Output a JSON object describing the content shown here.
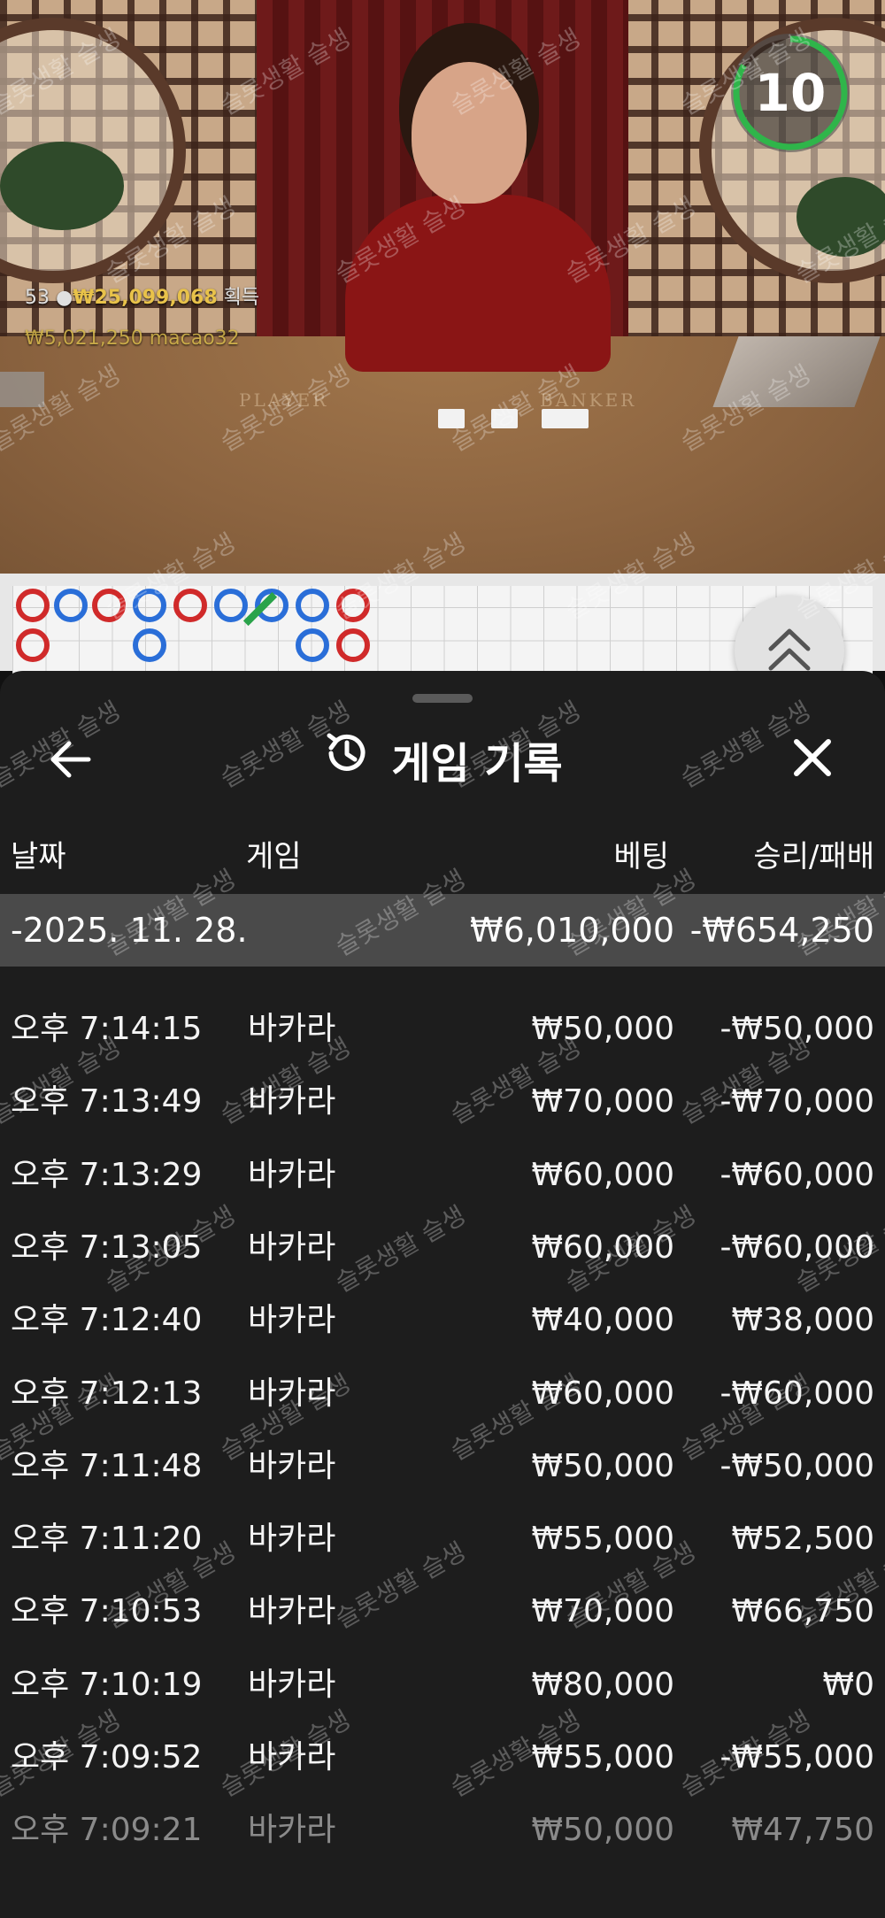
{
  "video": {
    "timer": "10",
    "win_count": "53",
    "win_amount": "₩25,099,068",
    "win_suffix": "획득",
    "user_line": "₩5,021,250 macao32",
    "felt_player": "PLAYER",
    "felt_banker": "BANKER"
  },
  "watermark": "슬롯생활 슬생",
  "panel": {
    "title": "게임 기록",
    "columns": {
      "date": "날짜",
      "game": "게임",
      "bet": "베팅",
      "result": "승리/패배"
    },
    "date_group": {
      "date": "-2025. 11. 28.",
      "bet": "₩6,010,000",
      "result": "-₩654,250"
    },
    "rows": [
      {
        "time": "오후 7:14:15",
        "game": "바카라",
        "bet": "₩50,000",
        "result": "-₩50,000"
      },
      {
        "time": "오후 7:13:49",
        "game": "바카라",
        "bet": "₩70,000",
        "result": "-₩70,000"
      },
      {
        "time": "오후 7:13:29",
        "game": "바카라",
        "bet": "₩60,000",
        "result": "-₩60,000"
      },
      {
        "time": "오후 7:13:05",
        "game": "바카라",
        "bet": "₩60,000",
        "result": "-₩60,000"
      },
      {
        "time": "오후 7:12:40",
        "game": "바카라",
        "bet": "₩40,000",
        "result": "₩38,000"
      },
      {
        "time": "오후 7:12:13",
        "game": "바카라",
        "bet": "₩60,000",
        "result": "-₩60,000"
      },
      {
        "time": "오후 7:11:48",
        "game": "바카라",
        "bet": "₩50,000",
        "result": "-₩50,000"
      },
      {
        "time": "오후 7:11:20",
        "game": "바카라",
        "bet": "₩55,000",
        "result": "₩52,500"
      },
      {
        "time": "오후 7:10:53",
        "game": "바카라",
        "bet": "₩70,000",
        "result": "₩66,750"
      },
      {
        "time": "오후 7:10:19",
        "game": "바카라",
        "bet": "₩80,000",
        "result": "₩0"
      },
      {
        "time": "오후 7:09:52",
        "game": "바카라",
        "bet": "₩55,000",
        "result": "-₩55,000"
      },
      {
        "time": "오후 7:09:21",
        "game": "바카라",
        "bet": "₩50,000",
        "result": "₩47,750"
      }
    ]
  },
  "colors": {
    "panel_bg": "#1d1d1d",
    "date_row_bg": "#4a4a4a",
    "timer_ring": "#2fb54a",
    "banker_red": "#d02a2a",
    "player_blue": "#2a6ed8",
    "win_gold": "#e8c24a"
  }
}
